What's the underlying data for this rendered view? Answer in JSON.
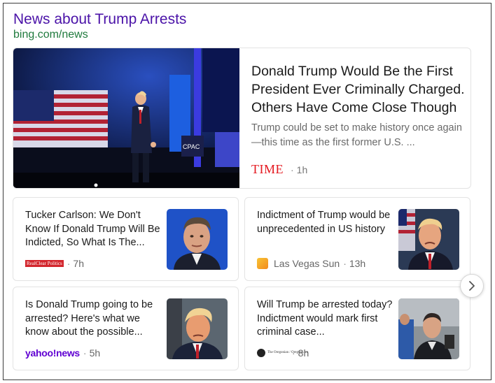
{
  "header": {
    "title": "News about Trump Arrests",
    "url": "bing.com/news"
  },
  "hero": {
    "headline": "Donald Trump Would Be the First President Ever Criminally Charged. Others Have Come Close Though",
    "snippet": "Trump could be set to make history once again—this time as the first former U.S. ...",
    "source": "TIME",
    "time": "1h",
    "image_sign_text": "CPAC"
  },
  "cards": [
    {
      "headline": "Tucker Carlson: We Don't Know If Donald Trump Will Be Indicted, So What Is The...",
      "source_logo": "RealClear Politics",
      "time": "7h"
    },
    {
      "headline": "Indictment of Trump would be unprecedented in US history",
      "source": "Las Vegas Sun",
      "time": "13h"
    },
    {
      "headline": "Is Donald Trump going to be arrested? Here's what we know about the possible...",
      "source_logo": "yahoo!news",
      "time": "5h"
    },
    {
      "headline": "Will Trump be arrested today? Indictment would mark first criminal case...",
      "source_logo": "The Oregonian / OregonLive",
      "time": "8h"
    }
  ],
  "colors": {
    "title": "#4b13a8",
    "url": "#1f7a3d",
    "time_brand": "#e4181f",
    "yahoo_brand": "#6001d2"
  },
  "icons": {
    "next": "chevron-right-icon"
  }
}
